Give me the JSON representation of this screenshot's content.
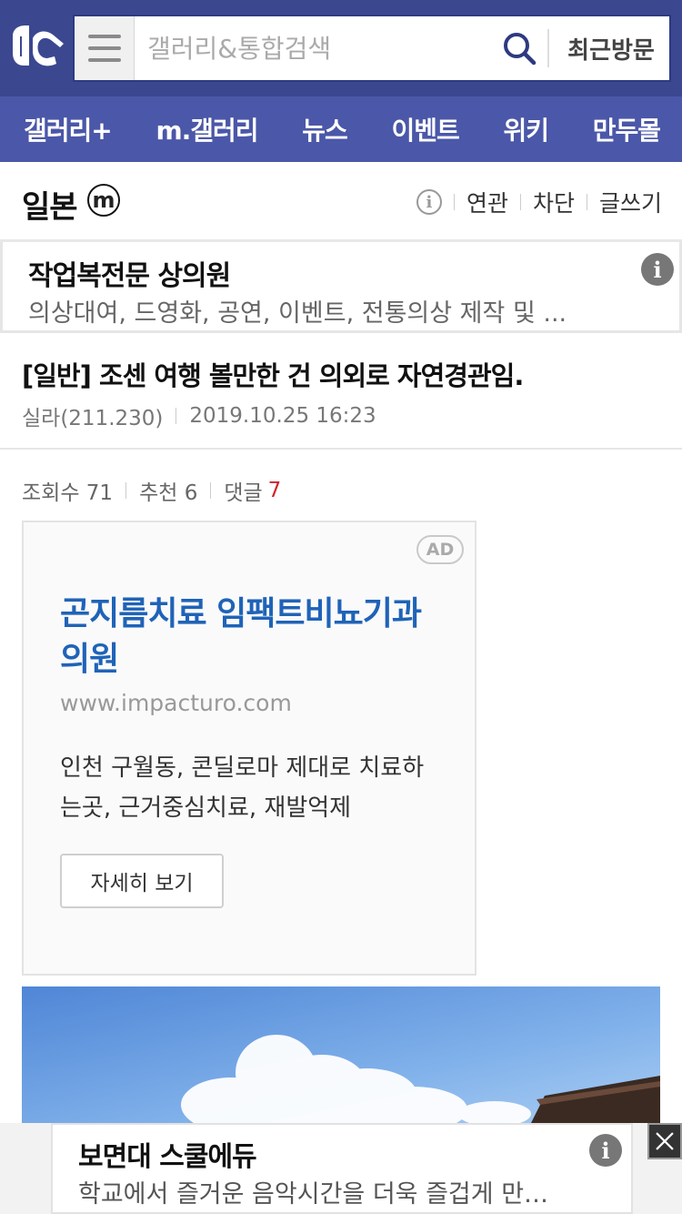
{
  "header": {
    "logo_icon": "dc-logo-icon",
    "search_placeholder": "갤러리&통합검색",
    "recent_label": "최근방문"
  },
  "nav": {
    "items": [
      "갤러리+",
      "m.갤러리",
      "뉴스",
      "이벤트",
      "위키",
      "만두몰"
    ]
  },
  "gallery": {
    "title": "일본",
    "minor_badge": "m",
    "info_icon": "i",
    "actions": [
      "연관",
      "차단",
      "글쓰기"
    ]
  },
  "top_ad": {
    "title": "작업복전문 상의원",
    "description": "의상대여, 드영화, 공연, 이벤트, 전통의상 제작 및 ...",
    "info_icon": "i"
  },
  "post": {
    "title": "[일반] 조센 여행 볼만한 건 의외로 자연경관임.",
    "author": "실라(211.230)",
    "date": "2019.10.25 16:23",
    "views_label": "조회수 71",
    "recommend_label": "추천 6",
    "comment_label": "댓글",
    "comment_count": "7"
  },
  "ad_card": {
    "badge": "AD",
    "title": "곤지름치료 임팩트비뇨기과의원",
    "url": "www.impacturo.com",
    "description": "인천 구월동, 콘딜로마 제대로 치료하는곳, 근거중심치료, 재발억제",
    "button_label": "자세히 보기"
  },
  "bottom_ad": {
    "title": "보면대 스쿨에듀",
    "description": "학교에서 즐거운 음악시간을 더욱 즐겁게 만들어 드립니다",
    "info_icon": "i"
  },
  "colors": {
    "header_bg": "#3b4890",
    "nav_bg": "#4b57a8",
    "ad_title": "#1f63b8",
    "comment_count": "#d0242e"
  }
}
